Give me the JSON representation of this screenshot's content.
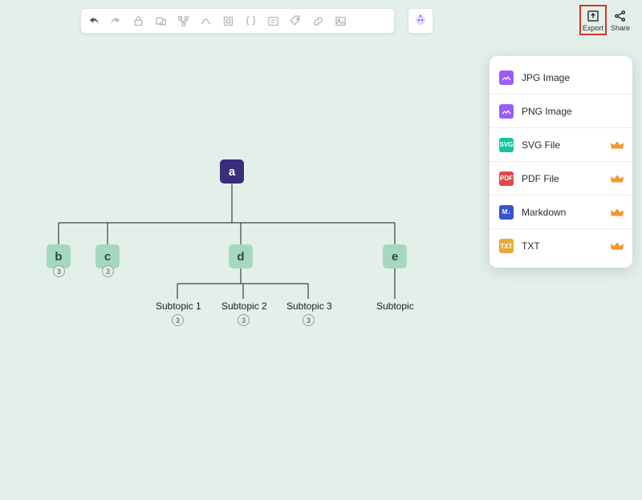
{
  "toolbar_icons": [
    "undo",
    "redo",
    "lock",
    "shape-edit",
    "branch",
    "path",
    "frame",
    "braces",
    "text",
    "tag",
    "link",
    "image"
  ],
  "export": {
    "label": "Export"
  },
  "share": {
    "label": "Share"
  },
  "menu": {
    "items": [
      {
        "label": "JPG Image",
        "premium": false
      },
      {
        "label": "PNG Image",
        "premium": false
      },
      {
        "label": "SVG File",
        "premium": true
      },
      {
        "label": "PDF File",
        "premium": true
      },
      {
        "label": "Markdown",
        "premium": true
      },
      {
        "label": "TXT",
        "premium": true
      }
    ]
  },
  "diagram": {
    "root": "a",
    "children": [
      {
        "label": "b",
        "badge": "3"
      },
      {
        "label": "c",
        "badge": "3"
      },
      {
        "label": "d",
        "subs": [
          {
            "label": "Subtopic 1",
            "badge": "3"
          },
          {
            "label": "Subtopic 2",
            "badge": "3"
          },
          {
            "label": "Subtopic 3",
            "badge": "3"
          }
        ]
      },
      {
        "label": "e",
        "subs": [
          {
            "label": "Subtopic"
          }
        ]
      }
    ]
  }
}
